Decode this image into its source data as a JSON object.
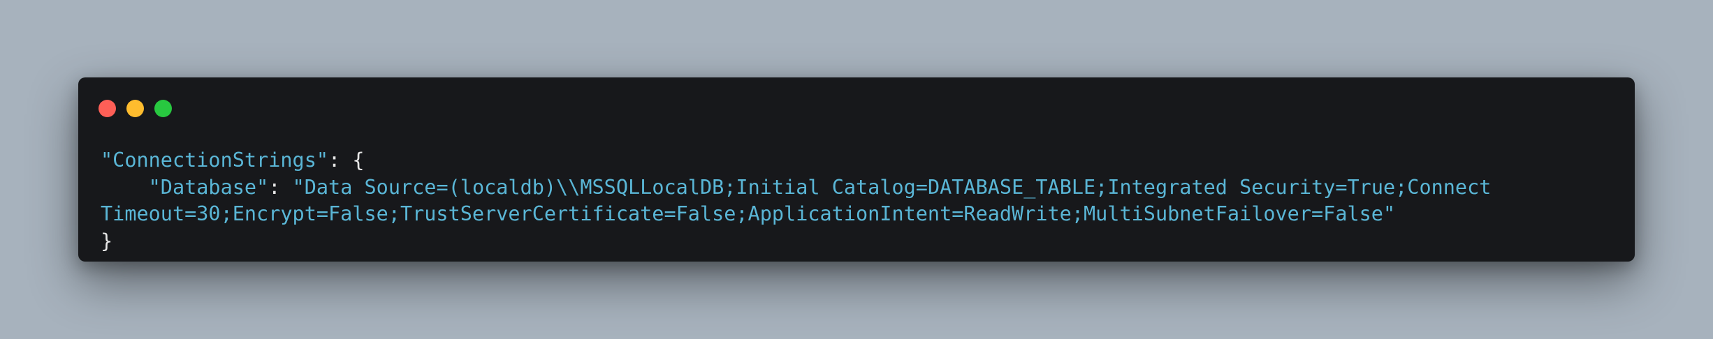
{
  "window": {
    "controls": {
      "close": "close",
      "minimize": "minimize",
      "zoom": "zoom"
    },
    "colors": {
      "background": "#a7b2bd",
      "panel": "#17181b",
      "string": "#5ab6d6",
      "punctuation": "#e6e6e6",
      "close": "#fe5f57",
      "minimize": "#febc2e",
      "zoom": "#28c840"
    }
  },
  "code": {
    "line1_key": "\"ConnectionStrings\"",
    "line1_punct": ": {",
    "line2_indent": "    ",
    "line2_key": "\"Database\"",
    "line2_colon": ": ",
    "line2_value_start": "\"Data Source=(localdb)\\\\MSSQLLocalDB;Initial Catalog=DATABASE_TABLE;Integrated Security=True;Connect",
    "line3_value_end": "Timeout=30;Encrypt=False;TrustServerCertificate=False;ApplicationIntent=ReadWrite;MultiSubnetFailover=False\"",
    "line4_close": "}"
  }
}
